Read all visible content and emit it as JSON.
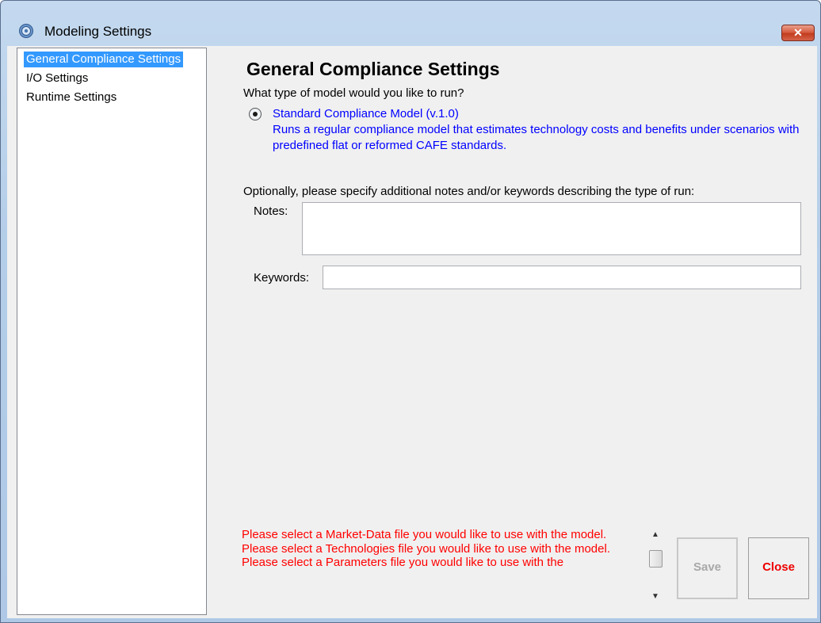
{
  "window": {
    "title": "Modeling Settings",
    "app_icon": "gear-app-icon",
    "close_glyph": "✕"
  },
  "nav": {
    "items": [
      {
        "label": "General Compliance Settings",
        "selected": true
      },
      {
        "label": "I/O Settings",
        "selected": false
      },
      {
        "label": "Runtime Settings",
        "selected": false
      }
    ]
  },
  "main": {
    "title": "General Compliance Settings",
    "question": "What type of model would you like to run?",
    "model_option": {
      "label": "Standard Compliance Model (v.1.0)",
      "selected": true,
      "description": "Runs a regular compliance model that estimates technology costs and benefits under scenarios with predefined flat or reformed CAFE standards."
    },
    "optional_prompt": "Optionally, please specify additional notes and/or keywords describing the type of run:",
    "notes": {
      "label": "Notes:",
      "value": ""
    },
    "keywords": {
      "label": "Keywords:",
      "value": ""
    }
  },
  "messages": [
    "Please select a Market-Data file you would like to use with the model.",
    "Please select a Technologies file you would like to use with the model.",
    "Please select a Parameters file you would like to use with the"
  ],
  "scrollbar": {
    "up_glyph": "▲",
    "down_glyph": "▼"
  },
  "buttons": {
    "save": {
      "label": "Save",
      "enabled": false
    },
    "close": {
      "label": "Close",
      "enabled": true
    }
  },
  "colors": {
    "accent_selection": "#3399ff",
    "radio_text": "#0000ff",
    "error_text": "#ff0000",
    "close_label": "#ee0000"
  }
}
